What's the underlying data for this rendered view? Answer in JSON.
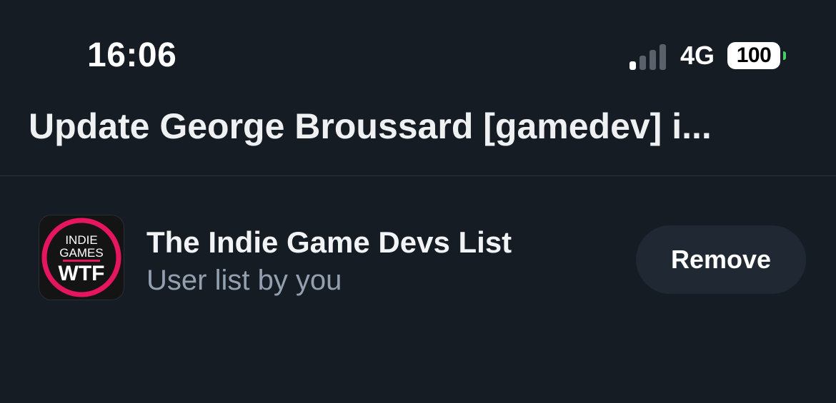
{
  "status_bar": {
    "time": "16:06",
    "network": "4G",
    "battery": "100",
    "signal_icon": "cellular-signal-icon"
  },
  "header": {
    "title": "Update George Broussard [gamedev] i..."
  },
  "lists": [
    {
      "name": "The Indie Game Devs List",
      "subtitle": "User list by you",
      "action_label": "Remove",
      "avatar": {
        "line1": "INDIE",
        "line2": "GAMES",
        "line3": "WTF"
      }
    }
  ],
  "colors": {
    "background": "#161c24",
    "button_bg": "#1f2833",
    "subtitle": "#93a0b0",
    "avatar_ring": "#e6155f",
    "battery_tip": "#43d065"
  }
}
